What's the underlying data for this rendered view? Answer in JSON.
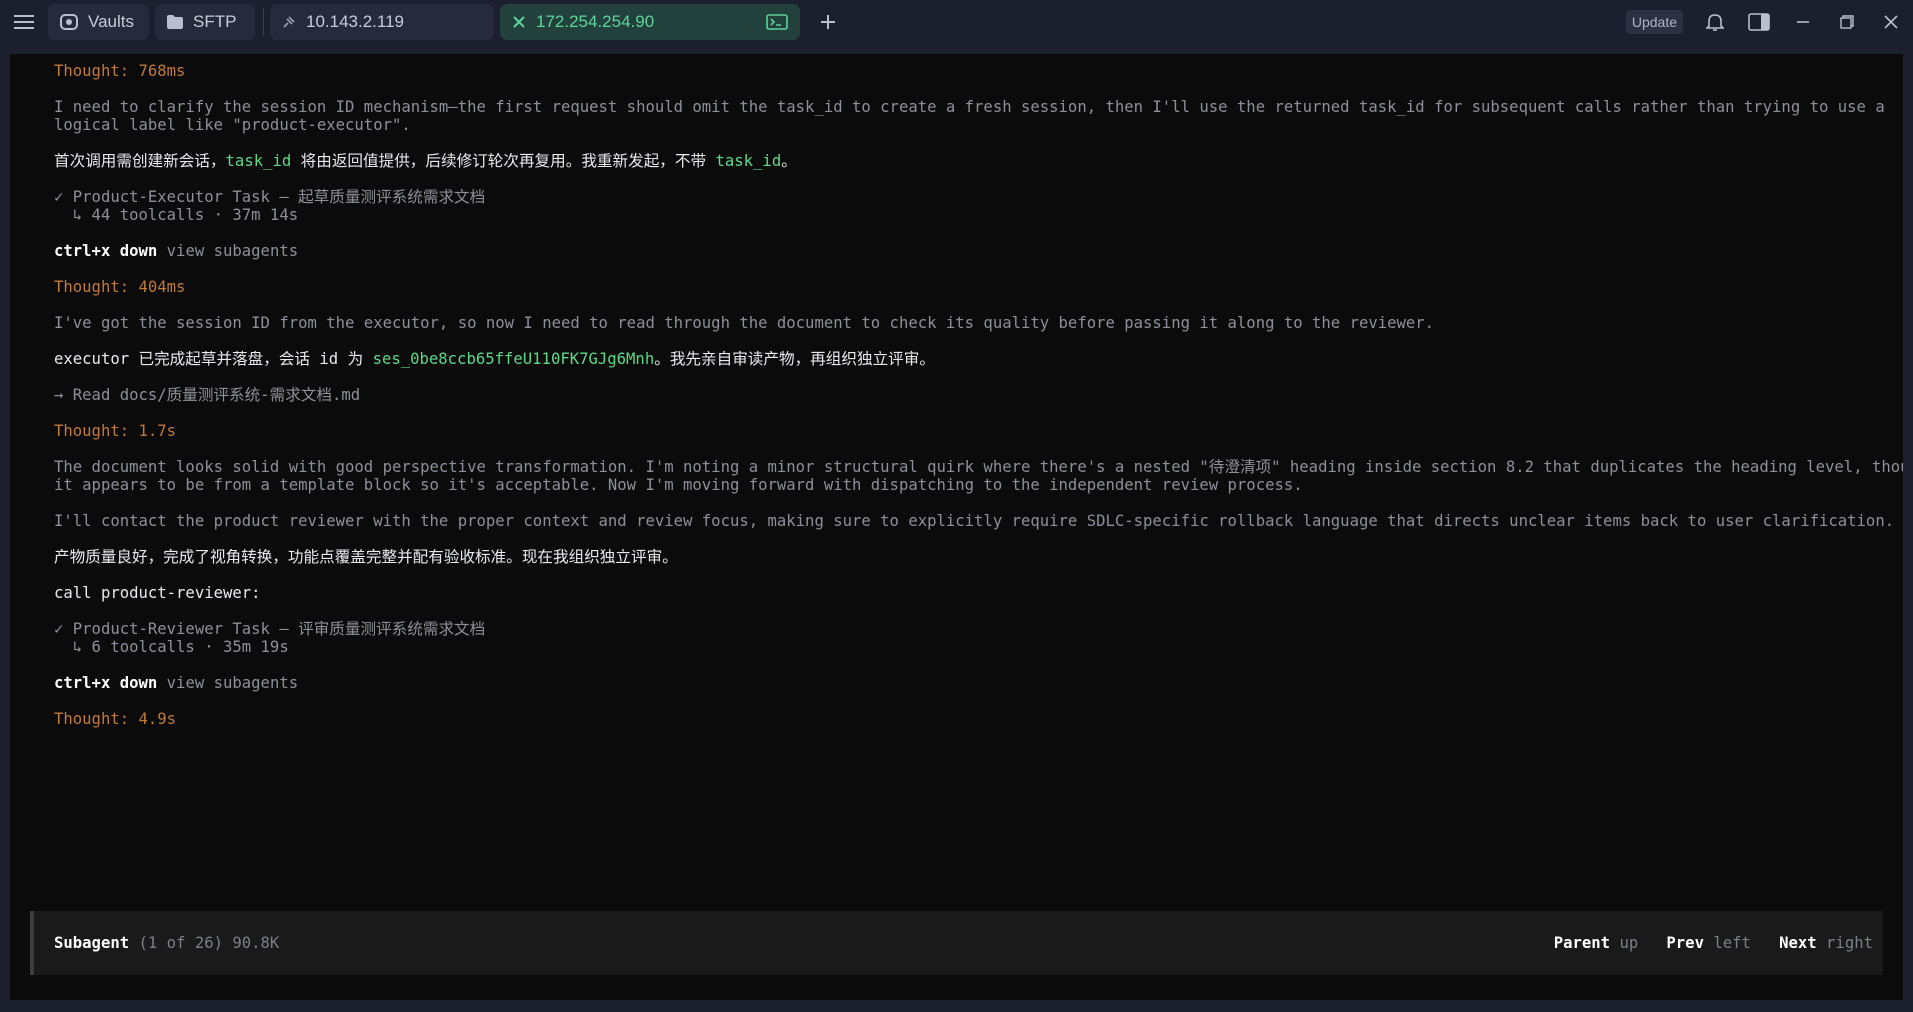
{
  "topbar": {
    "tabs": {
      "vaults": "Vaults",
      "sftp": "SFTP",
      "host1": "10.143.2.119",
      "host2": "172.254.254.90"
    },
    "update_label": "Update"
  },
  "terminal": {
    "lines": [
      {
        "text": "Thought: 768ms"
      },
      {
        "text": "I need to clarify the session ID mechanism—the first request should omit the task_id to create a fresh session, then I'll use the returned task_id for subsequent calls rather than trying to use a"
      },
      {
        "text": "logical label like \"product-executor\"."
      },
      {
        "p1": "首次调用需创建新会话，",
        "g1": "task_id",
        "p2": " 将由返回值提供，后续修订轮次再复用。我重新发起，不带 ",
        "g2": "task_id",
        "p3": "。"
      },
      {
        "text": "✓ Product-Executor Task — 起草质量测评系统需求文档"
      },
      {
        "text": "  ↳ 44 toolcalls · 37m 14s"
      },
      {
        "key": "ctrl+x down",
        "hint": " view subagents"
      },
      {
        "text": "Thought: 404ms"
      },
      {
        "text": "I've got the session ID from the executor, so now I need to read through the document to check its quality before passing it along to the reviewer."
      },
      {
        "p1": "executor 已完成起草并落盘，会话 id 为 ",
        "g1": "ses_0be8ccb65ffeU110FK7GJg6Mnh",
        "p2": "。我先亲自审读产物，再组织独立评审。"
      },
      {
        "text": "→ Read docs/质量测评系统-需求文档.md"
      },
      {
        "text": "Thought: 1.7s"
      },
      {
        "text": "The document looks solid with good perspective transformation. I'm noting a minor structural quirk where there's a nested \"待澄清项\" heading inside section 8.2 that duplicates the heading level, though"
      },
      {
        "text": "it appears to be from a template block so it's acceptable. Now I'm moving forward with dispatching to the independent review process."
      },
      {
        "text": "I'll contact the product reviewer with the proper context and review focus, making sure to explicitly require SDLC-specific rollback language that directs unclear items back to user clarification."
      },
      {
        "text": "产物质量良好，完成了视角转换，功能点覆盖完整并配有验收标准。现在我组织独立评审。"
      },
      {
        "text": "call product-reviewer:"
      },
      {
        "text": "✓ Product-Reviewer Task — 评审质量测评系统需求文档"
      },
      {
        "text": "  ↳ 6 toolcalls · 35m 19s"
      },
      {
        "key": "ctrl+x down",
        "hint": " view subagents"
      },
      {
        "text": "Thought: 4.9s"
      }
    ]
  },
  "footer": {
    "title": "Subagent",
    "meta": " (1 of 26) 90.8K",
    "parent_key": "Parent",
    "parent_hint": " up",
    "prev_key": "Prev",
    "prev_hint": " left",
    "next_key": "Next",
    "next_hint": " right"
  }
}
